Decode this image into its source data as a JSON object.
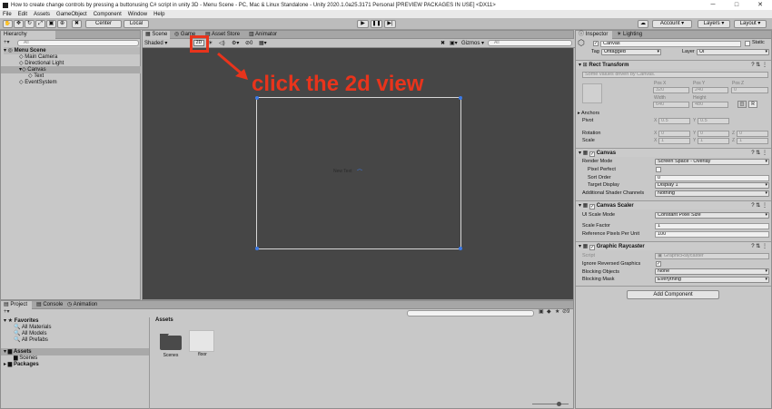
{
  "window": {
    "title": "How to create change controls by pressing a buttonusing C# script in unity 3D - Menu Scene - PC, Mac & Linux Standalone - Unity 2020.1.0a25.3171 Personal [PREVIEW PACKAGES IN USE] <DX11>",
    "min": "─",
    "max": "□",
    "close": "✕"
  },
  "menu": [
    "File",
    "Edit",
    "Assets",
    "GameObject",
    "Component",
    "Window",
    "Help"
  ],
  "toolbar": {
    "center": "Center",
    "local": "Local",
    "account": "Account",
    "layers": "Layers",
    "layout": "Layout"
  },
  "hierarchy": {
    "tab": "Hierarchy",
    "search": "All",
    "items": [
      {
        "label": "Menu Scene"
      },
      {
        "label": "Main Camera"
      },
      {
        "label": "Directional Light"
      },
      {
        "label": "Canvas"
      },
      {
        "label": "Text"
      },
      {
        "label": "EventSystem"
      }
    ]
  },
  "scene": {
    "tabs": [
      "Scene",
      "Game",
      "Asset Store",
      "Animator"
    ],
    "shading": "Shaded",
    "mode2d": "2D",
    "audio_count": "0",
    "gizmos": "Gizmos",
    "search": "All",
    "annotation": "click the 2d view",
    "canvas_text": "New Text",
    "annotation_color": "#e8341c"
  },
  "project": {
    "tabs": [
      "Project",
      "Console",
      "Animation"
    ],
    "favorites": {
      "label": "Favorites",
      "items": [
        "All Materials",
        "All Models",
        "All Prefabs"
      ]
    },
    "assets": {
      "label": "Assets",
      "children": [
        "Scenes"
      ]
    },
    "packages": "Packages",
    "breadcrumb": "Assets",
    "files": [
      {
        "name": "Scenes"
      },
      {
        "name": "floor"
      }
    ],
    "hidden_count": "9"
  },
  "inspector": {
    "tabs": [
      "Inspector",
      "Lighting"
    ],
    "object_name": "Canvas",
    "static_label": "Static",
    "tag_label": "Tag",
    "tag_value": "Untagged",
    "layer_label": "Layer",
    "layer_value": "UI",
    "rect": {
      "title": "Rect Transform",
      "note": "Some values driven by Canvas.",
      "pos_x_label": "Pos X",
      "pos_x": "320",
      "pos_y_label": "Pos Y",
      "pos_y": "240",
      "pos_z_label": "Pos Z",
      "pos_z": "0",
      "width_label": "Width",
      "width": "640",
      "height_label": "Height",
      "height": "480",
      "anchors": "Anchors",
      "pivot": "Pivot",
      "pivot_x": "0.5",
      "pivot_y": "0.5",
      "rotation": "Rotation",
      "rot_x": "0",
      "rot_y": "0",
      "rot_z": "0",
      "scale": "Scale",
      "scale_x": "1",
      "scale_y": "1",
      "scale_z": "1",
      "x": "X",
      "y": "Y",
      "z": "Z",
      "r": "R"
    },
    "canvas": {
      "title": "Canvas",
      "render_mode_label": "Render Mode",
      "render_mode": "Screen Space - Overlay",
      "pixel_perfect": "Pixel Perfect",
      "sort_order_label": "Sort Order",
      "sort_order": "0",
      "target_display_label": "Target Display",
      "target_display": "Display 1",
      "shader_channels_label": "Additional Shader Channels",
      "shader_channels": "Nothing"
    },
    "scaler": {
      "title": "Canvas Scaler",
      "ui_scale_mode_label": "UI Scale Mode",
      "ui_scale_mode": "Constant Pixel Size",
      "scale_factor_label": "Scale Factor",
      "scale_factor": "1",
      "ref_ppu_label": "Reference Pixels Per Unit",
      "ref_ppu": "100"
    },
    "raycaster": {
      "title": "Graphic Raycaster",
      "script_label": "Script",
      "script": "GraphicRaycaster",
      "ignore_label": "Ignore Reversed Graphics",
      "blocking_objects_label": "Blocking Objects",
      "blocking_objects": "None",
      "blocking_mask_label": "Blocking Mask",
      "blocking_mask": "Everything"
    },
    "add_component": "Add Component"
  }
}
